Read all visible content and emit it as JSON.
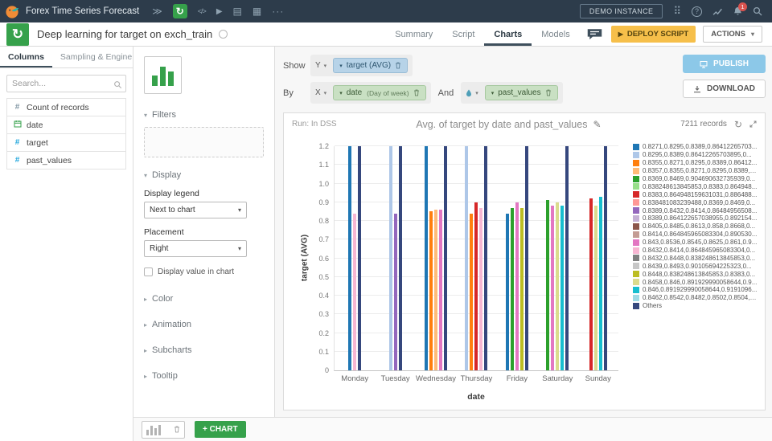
{
  "glyphs": {
    "caret_down": "▾",
    "caret_right": "▸",
    "play": "▶",
    "refresh": "↻",
    "pencil": "✎",
    "ellipsis": "···",
    "chevrons": "≫",
    "grid_dots": "⠿",
    "recipe": "↻",
    "hash": "#",
    "code": "</>",
    "nav_icon_a": "▤",
    "nav_icon_b": "▦",
    "question": "?"
  },
  "top_nav": {
    "project": "Forex Time Series Forecast",
    "demo_instance": "DEMO INSTANCE",
    "notif_count": "1"
  },
  "header": {
    "title": "Deep learning for target on exch_train",
    "tabs": [
      {
        "label": "Summary"
      },
      {
        "label": "Script"
      },
      {
        "label": "Charts"
      },
      {
        "label": "Models"
      }
    ],
    "deploy_label": "DEPLOY SCRIPT",
    "actions_label": "ACTIONS"
  },
  "sidebar": {
    "tab_columns": "Columns",
    "tab_sampling": "Sampling & Engine",
    "search_placeholder": "Search...",
    "items": [
      {
        "label": "Count of records"
      },
      {
        "label": "date"
      },
      {
        "label": "target"
      },
      {
        "label": "past_values"
      }
    ]
  },
  "config": {
    "filters_label": "Filters",
    "display_label": "Display",
    "display_legend_label": "Display legend",
    "display_legend_value": "Next to chart",
    "placement_label": "Placement",
    "placement_value": "Right",
    "display_value_label": "Display value in chart",
    "color_label": "Color",
    "animation_label": "Animation",
    "subcharts_label": "Subcharts",
    "tooltip_label": "Tooltip"
  },
  "controls": {
    "show_label": "Show",
    "y_label": "Y",
    "y_token": "target (AVG)",
    "by_label": "By",
    "x_label": "X",
    "x_token_main": "date",
    "x_token_sub": "(Day of week)",
    "and_label": "And",
    "and_token": "past_values",
    "publish_label": "PUBLISH",
    "download_label": "DOWNLOAD"
  },
  "card": {
    "run_label": "Run: In DSS",
    "title": "Avg. of target by date and past_values",
    "records": "7211 records"
  },
  "footer": {
    "add_chart_label": "+ CHART"
  },
  "chart_data": {
    "type": "bar",
    "title": "Avg. of target by date and past_values",
    "xlabel": "date",
    "ylabel": "target (AVG)",
    "ylim": [
      0,
      1.2
    ],
    "yticks": [
      1.2,
      1.1,
      1.0,
      0.9,
      0.8,
      0.7,
      0.6,
      0.5,
      0.4,
      0.3,
      0.2,
      0.1,
      0
    ],
    "grid": true,
    "legend_position": "right",
    "categories": [
      "Monday",
      "Tuesday",
      "Wednesday",
      "Thursday",
      "Friday",
      "Saturday",
      "Sunday"
    ],
    "palette": [
      "#1f77b4",
      "#aec7e8",
      "#ff7f0e",
      "#ffbb78",
      "#2ca02c",
      "#98df8a",
      "#d62728",
      "#ff9896",
      "#9467bd",
      "#c5b0d5",
      "#8c564b",
      "#c49c94",
      "#e377c2",
      "#f7b6d2",
      "#7f7f7f",
      "#c7c7c7",
      "#bcbd22",
      "#dbdb8d",
      "#17becf",
      "#9edae5",
      "#35477d"
    ],
    "legend": [
      "0.8271,0.8295,0.8389,0.86412265703...",
      "0.8295,0.8389,0.86412265703895,0...",
      "0.8355,0.8271,0.8295,0.8389,0.86412...",
      "0.8357,0.8355,0.8271,0.8295,0.8389,0...",
      "0.8369,0.8469,0.904690632735939,0...",
      "0.838248613845853,0.8383,0.864948...",
      "0.8383,0.864948159631031,0.886488...",
      "0.838481083239488,0.8369,0.8469,0...",
      "0.8389,0.8432,0.8414,0.86484956508...",
      "0.8389,0.864122657038955,0.892154...",
      "0.8405,0.8485,0.8613,0.858,0.8668,0...",
      "0.8414,0.864845965083304,0.890530...",
      "0.843,0.8536,0.8545,0.8625,0.861,0.9...",
      "0.8432,0.8414,0.864845965083304,0...",
      "0.8432,0.8448,0.838248613845853,0...",
      "0.8439,0.8493,0.90105694225323,0...",
      "0.8448,0.838248613845853,0.8383,0...",
      "0.8458,0.846,0.891929990058644,0.9...",
      "0.846,0.891929990058644,0.9191096...",
      "0.8462,0.8542,0.8482,0.8502,0.8504,0...",
      "Others"
    ],
    "groups": [
      [
        [
          0,
          1.2
        ],
        [
          13,
          0.84
        ],
        [
          20,
          1.2
        ]
      ],
      [
        [
          1,
          1.2
        ],
        [
          8,
          0.84
        ],
        [
          20,
          1.2
        ]
      ],
      [
        [
          0,
          1.2
        ],
        [
          2,
          0.85
        ],
        [
          3,
          0.86
        ],
        [
          12,
          0.86
        ],
        [
          20,
          1.2
        ]
      ],
      [
        [
          1,
          1.2
        ],
        [
          2,
          0.84
        ],
        [
          6,
          0.9
        ],
        [
          13,
          0.87
        ],
        [
          20,
          1.2
        ]
      ],
      [
        [
          0,
          0.84
        ],
        [
          4,
          0.87
        ],
        [
          12,
          0.9
        ],
        [
          16,
          0.87
        ],
        [
          20,
          1.2
        ]
      ],
      [
        [
          4,
          0.91
        ],
        [
          12,
          0.88
        ],
        [
          17,
          0.9
        ],
        [
          18,
          0.88
        ],
        [
          20,
          1.2
        ]
      ],
      [
        [
          6,
          0.92
        ],
        [
          17,
          0.88
        ],
        [
          18,
          0.93
        ],
        [
          20,
          1.2
        ]
      ]
    ]
  }
}
